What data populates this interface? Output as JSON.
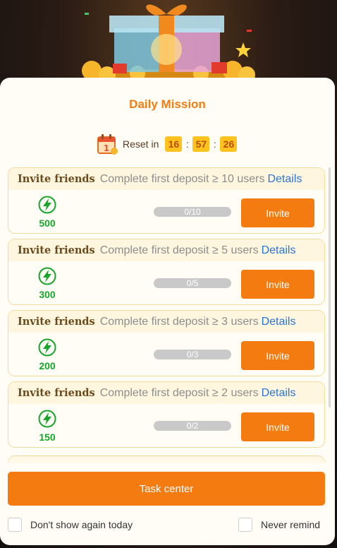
{
  "modal": {
    "title": "Daily Mission",
    "reset_label": "Reset in",
    "timer": {
      "hours": "16",
      "minutes": "57",
      "seconds": "26",
      "separator": ":"
    }
  },
  "missions": [
    {
      "type": "Invite friends",
      "description": "Complete first deposit ≥ 10 users",
      "details_label": "Details",
      "reward": "500",
      "progress_text": "0/10",
      "progress_fraction": 0,
      "button_label": "Invite"
    },
    {
      "type": "Invite friends",
      "description": "Complete first deposit ≥ 5 users",
      "details_label": "Details",
      "reward": "300",
      "progress_text": "0/5",
      "progress_fraction": 0,
      "button_label": "Invite"
    },
    {
      "type": "Invite friends",
      "description": "Complete first deposit ≥ 3 users",
      "details_label": "Details",
      "reward": "200",
      "progress_text": "0/3",
      "progress_fraction": 0,
      "button_label": "Invite"
    },
    {
      "type": "Invite friends",
      "description": "Complete first deposit ≥ 2 users",
      "details_label": "Details",
      "reward": "150",
      "progress_text": "0/2",
      "progress_fraction": 0,
      "button_label": "Invite"
    }
  ],
  "footer": {
    "task_center_label": "Task center",
    "dont_show_label": "Don't show again today",
    "never_remind_label": "Never remind"
  },
  "icons": {
    "reward": "lightning-bolt-icon",
    "reset": "calendar-icon"
  },
  "colors": {
    "accent": "#f47b10",
    "title": "#f07c12",
    "reward_green": "#17a52a",
    "link": "#2a74d4",
    "timer_bg": "#ffc21f"
  }
}
